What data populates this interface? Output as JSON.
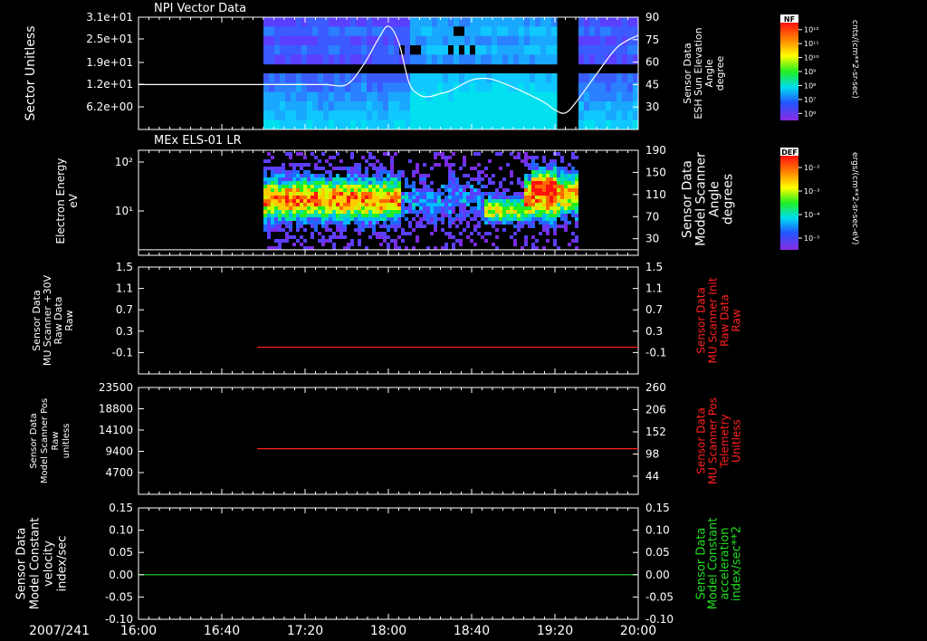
{
  "chart_data": [
    {
      "type": "heatmap",
      "title": "NPI Vector Data",
      "ylabel": "Sector Unitless",
      "yticks": [
        "3.1e+01",
        "2.5e+01",
        "1.9e+01",
        "1.2e+01",
        "6.2e+00"
      ],
      "y2label": [
        "Sensor Data",
        "ESH Sun Elevation",
        "Angle",
        "degree"
      ],
      "y2ticks": [
        "90",
        "75",
        "60",
        "45",
        "30"
      ],
      "y2lim": [
        15,
        90
      ],
      "data_gaps": [
        [
          "16:00",
          "17:00"
        ],
        [
          "19:20",
          "19:29"
        ]
      ],
      "overlay_line": {
        "x": [
          "16:00",
          "17:00",
          "17:20",
          "17:30",
          "17:40",
          "17:48",
          "17:55",
          "18:00",
          "18:05",
          "18:10",
          "18:15",
          "18:20",
          "18:25",
          "18:30",
          "18:40",
          "18:48",
          "18:55",
          "19:05",
          "19:15",
          "19:20",
          "19:25",
          "19:30",
          "19:40",
          "19:50",
          "20:00"
        ],
        "y": [
          45,
          45,
          45,
          45,
          45,
          58,
          75,
          84,
          73,
          46,
          38,
          37,
          39,
          41,
          48,
          49,
          46,
          40,
          33,
          28,
          26,
          33,
          52,
          70,
          78
        ]
      },
      "colorbar": {
        "label": "NF",
        "unit": "cnts/(cm**2-sr-sec)",
        "ticks": [
          "10¹²",
          "10¹¹",
          "10¹⁰",
          "10⁹",
          "10⁸",
          "10⁷",
          "10⁶"
        ]
      }
    },
    {
      "type": "heatmap",
      "title": "MEx ELS-01 LR",
      "ylabel": [
        "Electron Energy",
        "eV"
      ],
      "yticks": [
        "10²",
        "10¹"
      ],
      "y2label": [
        "Sensor Data",
        "Model Scanner",
        "Angle",
        "degrees"
      ],
      "y2ticks": [
        "190",
        "150",
        "110",
        "70",
        "30"
      ],
      "y2lim": [
        0,
        190
      ],
      "data_range": [
        "17:00",
        "19:30"
      ],
      "constant_line_y2": 10,
      "colorbar": {
        "label": "DEF",
        "unit": "ergs/(cm**2-sr-sec-eV)",
        "ticks": [
          "10⁻²",
          "10⁻³",
          "10⁻⁴",
          "10⁻⁵"
        ]
      }
    },
    {
      "type": "line",
      "ylabel": [
        "Sensor Data",
        "MU Scanner +30V",
        "Raw Data",
        "Raw"
      ],
      "yticks": [
        "1.5",
        "1.1",
        "0.7",
        "0.3",
        "-0.1"
      ],
      "ylim": [
        -0.5,
        1.5
      ],
      "y2label": [
        "Sensor Data",
        "MU Scanner Init",
        "Raw Data",
        "Raw"
      ],
      "y2ticks": [
        "1.5",
        "1.1",
        "0.7",
        "0.3",
        "-0.1"
      ],
      "y2lim": [
        -0.5,
        1.5
      ],
      "series": [
        {
          "x": [
            "16:57",
            "20:00"
          ],
          "values": [
            0.0,
            0.0
          ],
          "color": "#ff2020",
          "axis": "y2"
        }
      ]
    },
    {
      "type": "line",
      "ylabel": [
        "Sensor Data",
        "Model Scanner Pos",
        "Raw",
        "unitless"
      ],
      "yticks": [
        "23500",
        "18800",
        "14100",
        "9400",
        "4700"
      ],
      "ylim": [
        0,
        23500
      ],
      "y2label": [
        "Sensor Data",
        "MU Scanner Pos",
        "Telemetry",
        "Unitless"
      ],
      "y2ticks": [
        "260",
        "206",
        "152",
        "98",
        "44"
      ],
      "y2lim": [
        0,
        260
      ],
      "series": [
        {
          "x": [
            "16:57",
            "20:00"
          ],
          "values": [
            111,
            111
          ],
          "color": "#ff2020",
          "axis": "y2"
        }
      ]
    },
    {
      "type": "line",
      "ylabel": [
        "Sensor Data",
        "Model Constant",
        "velocity",
        "index/sec"
      ],
      "yticks": [
        "0.15",
        "0.10",
        "0.05",
        "0.00",
        "-0.05",
        "-0.10"
      ],
      "ylim": [
        -0.1,
        0.15
      ],
      "y2label": [
        "Sensor Data",
        "Model Constant",
        "acceleration",
        "index/sec**2"
      ],
      "y2ticks": [
        "0.15",
        "0.10",
        "0.05",
        "0.00",
        "-0.05",
        "-0.10"
      ],
      "y2lim": [
        -0.1,
        0.15
      ],
      "series": [
        {
          "x": [
            "16:00",
            "20:00"
          ],
          "values": [
            0.0,
            0.0
          ],
          "color": "#22dd22",
          "axis": "y"
        }
      ]
    }
  ],
  "xaxis": {
    "date": "2007/241",
    "ticks": [
      "16:00",
      "16:40",
      "17:20",
      "18:00",
      "18:40",
      "19:20",
      "20:00"
    ],
    "xlim": [
      "16:00",
      "20:00"
    ]
  },
  "colors": {
    "background": "#000000",
    "axes": "#ffffff",
    "red_label": "#ff2020",
    "green_label": "#22dd22"
  }
}
